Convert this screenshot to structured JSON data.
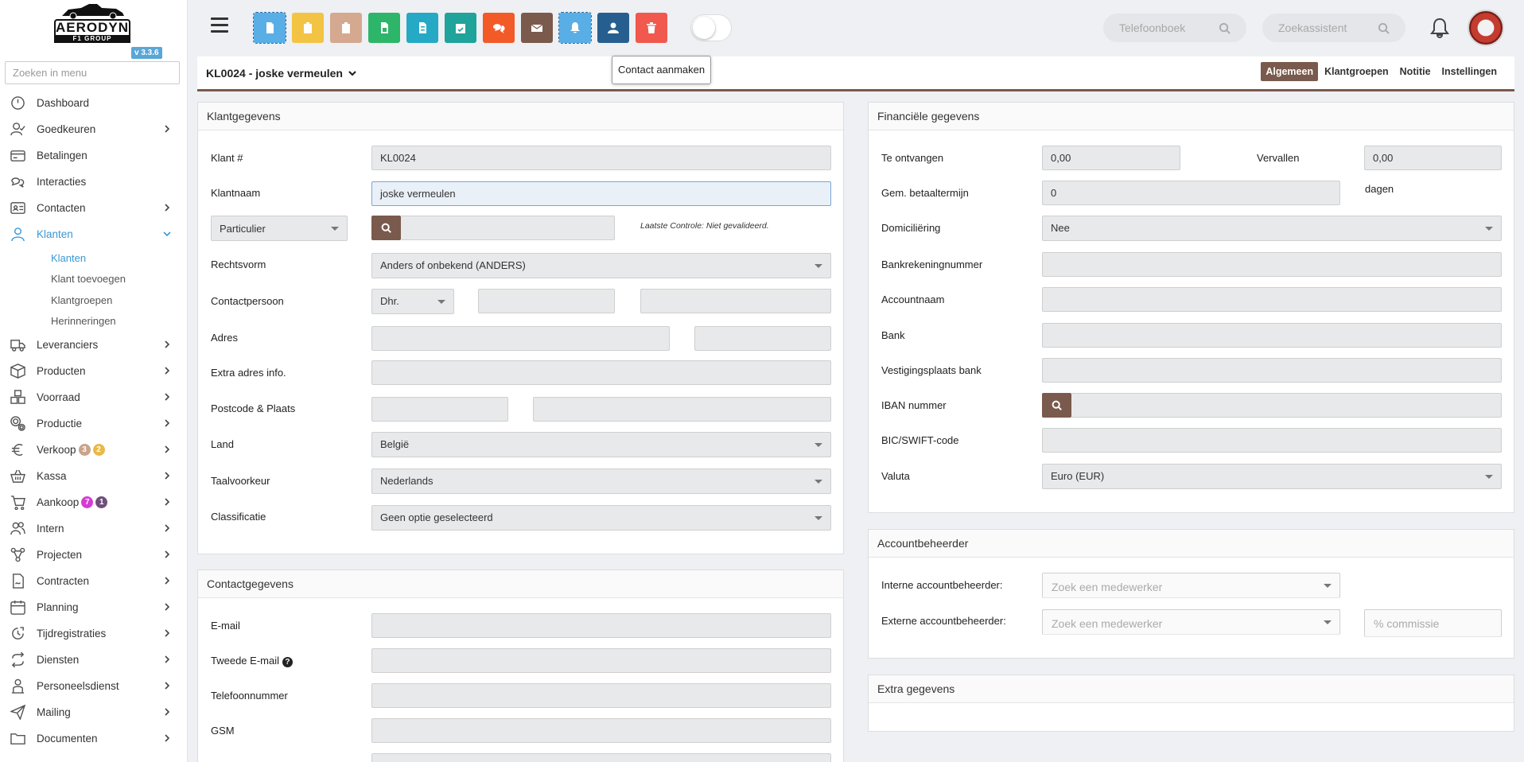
{
  "app": {
    "logo_brand": "AERODYN",
    "logo_sub": "F1 GROUP",
    "version": "v 3.3.6",
    "menu_search_placeholder": "Zoeken in menu"
  },
  "sidebar": {
    "items": [
      {
        "label": "Dashboard",
        "icon": "dashboard-icon",
        "chevron": false
      },
      {
        "label": "Goedkeuren",
        "icon": "user-check-icon",
        "chevron": true
      },
      {
        "label": "Betalingen",
        "icon": "credit-card-icon",
        "chevron": false
      },
      {
        "label": "Interacties",
        "icon": "chat-icon",
        "chevron": false
      },
      {
        "label": "Contacten",
        "icon": "id-card-icon",
        "chevron": true
      },
      {
        "label": "Klanten",
        "icon": "user-icon",
        "chevron": true,
        "active": true
      },
      {
        "label": "Leveranciers",
        "icon": "truck-icon",
        "chevron": true
      },
      {
        "label": "Producten",
        "icon": "box-icon",
        "chevron": true
      },
      {
        "label": "Voorraad",
        "icon": "boxes-icon",
        "chevron": true
      },
      {
        "label": "Productie",
        "icon": "gears-icon",
        "chevron": true
      },
      {
        "label": "Verkoop",
        "icon": "euro-icon",
        "chevron": true,
        "badges": [
          {
            "value": "3",
            "color": "#c9a48a"
          },
          {
            "value": "2",
            "color": "#e9b949"
          }
        ]
      },
      {
        "label": "Kassa",
        "icon": "basket-icon",
        "chevron": true
      },
      {
        "label": "Aankoop",
        "icon": "cart-icon",
        "chevron": true,
        "badges": [
          {
            "value": "7",
            "color": "#d63bd6"
          },
          {
            "value": "1",
            "color": "#6e4f7a"
          }
        ]
      },
      {
        "label": "Intern",
        "icon": "users-icon",
        "chevron": true
      },
      {
        "label": "Projecten",
        "icon": "project-icon",
        "chevron": true
      },
      {
        "label": "Contracten",
        "icon": "contract-icon",
        "chevron": true
      },
      {
        "label": "Planning",
        "icon": "calendar-icon",
        "chevron": true
      },
      {
        "label": "Tijdregistraties",
        "icon": "clock-icon",
        "chevron": true
      },
      {
        "label": "Diensten",
        "icon": "repeat-icon",
        "chevron": true
      },
      {
        "label": "Personeelsdienst",
        "icon": "person-icon",
        "chevron": true
      },
      {
        "label": "Mailing",
        "icon": "paper-plane-icon",
        "chevron": true
      },
      {
        "label": "Documenten",
        "icon": "folder-icon",
        "chevron": true
      }
    ],
    "sub_items": [
      "Klanten",
      "Klant toevoegen",
      "Klantgroepen",
      "Herinneringen"
    ]
  },
  "toolbar": {
    "buttons": [
      {
        "name": "document-button",
        "color": "#5aaee6",
        "icon": "document-icon"
      },
      {
        "name": "clipboard-yellow-button",
        "color": "#f3c343",
        "icon": "clipboard-icon"
      },
      {
        "name": "clipboard-tan-button",
        "color": "#d5a890",
        "icon": "clipboard-icon"
      },
      {
        "name": "spreadsheet-button",
        "color": "#2db56a",
        "icon": "spreadsheet-icon"
      },
      {
        "name": "invoice-button",
        "color": "#26a9c4",
        "icon": "invoice-icon"
      },
      {
        "name": "calendar-check-button",
        "color": "#1fa39a",
        "icon": "calendar-check-icon"
      },
      {
        "name": "chat-button",
        "color": "#f25a28",
        "icon": "chat-bubbles-icon"
      },
      {
        "name": "mail-button",
        "color": "#7a5a4c",
        "icon": "envelope-icon"
      },
      {
        "name": "bell-button",
        "color": "#5aaee6",
        "icon": "bell-icon"
      },
      {
        "name": "contact-button",
        "color": "#265f8f",
        "icon": "user-icon"
      },
      {
        "name": "delete-button",
        "color": "#f1584e",
        "icon": "trash-icon"
      }
    ],
    "tooltip": "Contact aanmaken",
    "phonebook_placeholder": "Telefoonboek",
    "assistant_placeholder": "Zoekassistent"
  },
  "header": {
    "title": "KL0024 - joske vermeulen",
    "tabs": [
      "Algemeen",
      "Klantgroepen",
      "Notitie",
      "Instellingen"
    ]
  },
  "klant": {
    "title": "Klantgegevens",
    "klant_nr_label": "Klant #",
    "klant_nr_value": "KL0024",
    "klantnaam_label": "Klantnaam",
    "klantnaam_value": "joske vermeulen",
    "type_value": "Particulier",
    "laatste_controle": "Laatste Controle: Niet gevalideerd.",
    "rechtsvorm_label": "Rechtsvorm",
    "rechtsvorm_value": "Anders of onbekend (ANDERS)",
    "contactpersoon_label": "Contactpersoon",
    "aanspreek_value": "Dhr.",
    "adres_label": "Adres",
    "extra_adres_label": "Extra adres info.",
    "postcode_label": "Postcode & Plaats",
    "land_label": "Land",
    "land_value": "België",
    "taal_label": "Taalvoorkeur",
    "taal_value": "Nederlands",
    "classificatie_label": "Classificatie",
    "classificatie_value": "Geen optie geselecteerd"
  },
  "contact": {
    "title": "Contactgegevens",
    "email_label": "E-mail",
    "email2_label": "Tweede E-mail",
    "telefoon_label": "Telefoonnummer",
    "gsm_label": "GSM"
  },
  "financieel": {
    "title": "Financiële gegevens",
    "te_ontvangen_label": "Te ontvangen",
    "te_ontvangen_value": "0,00",
    "vervallen_label": "Vervallen",
    "vervallen_value": "0,00",
    "betaaltermijn_label": "Gem. betaaltermijn",
    "betaaltermijn_value": "0",
    "dagen_label": "dagen",
    "domiciliering_label": "Domiciliëring",
    "domiciliering_value": "Nee",
    "bankrekening_label": "Bankrekeningnummer",
    "accountnaam_label": "Accountnaam",
    "bank_label": "Bank",
    "vestigingsplaats_label": "Vestigingsplaats bank",
    "iban_label": "IBAN nummer",
    "bic_label": "BIC/SWIFT-code",
    "valuta_label": "Valuta",
    "valuta_value": "Euro (EUR)"
  },
  "account": {
    "title": "Accountbeheerder",
    "intern_label": "Interne accountbeheerder:",
    "intern_placeholder": "Zoek een medewerker",
    "extern_label": "Externe accountbeheerder:",
    "extern_placeholder": "Zoek een medewerker",
    "commissie_placeholder": "% commissie"
  },
  "extra": {
    "title": "Extra gegevens"
  }
}
